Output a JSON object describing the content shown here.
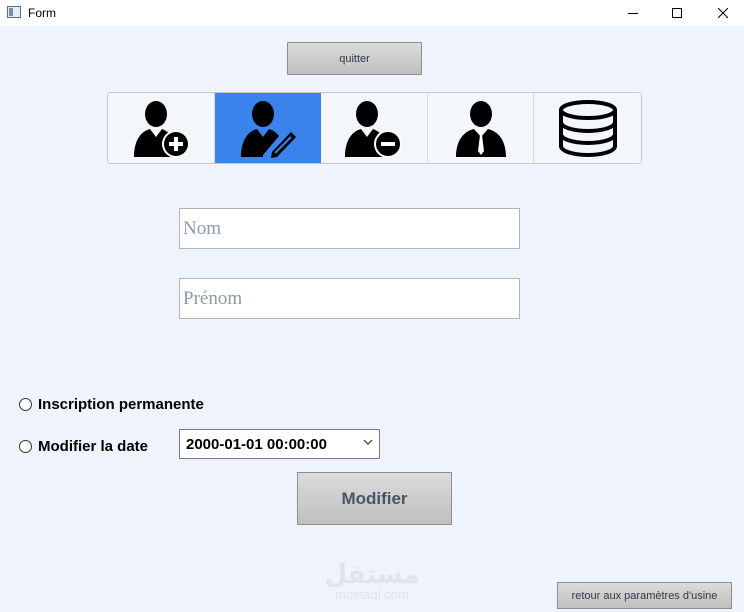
{
  "window": {
    "title": "Form",
    "controls": {
      "minimize_icon": "minimize-icon",
      "maximize_icon": "maximize-icon",
      "close_icon": "close-icon"
    }
  },
  "toolbar_top": {
    "quit_label": "quitter"
  },
  "tools": [
    {
      "id": "add-user",
      "icon": "user-add-icon",
      "active": false
    },
    {
      "id": "edit-user",
      "icon": "user-edit-icon",
      "active": true
    },
    {
      "id": "remove-user",
      "icon": "user-remove-icon",
      "active": false
    },
    {
      "id": "users",
      "icon": "user-tie-icon",
      "active": false
    },
    {
      "id": "database",
      "icon": "database-icon",
      "active": false
    }
  ],
  "form": {
    "nom_placeholder": "Nom",
    "prenom_placeholder": "Prénom",
    "nom_value": "",
    "prenom_value": "",
    "radio_permanent": "Inscription permanente",
    "radio_date": "Modifier la date",
    "date_value": "2000-01-01 00:00:00",
    "modify_label": "Modifier"
  },
  "footer": {
    "factory_reset_label": "retour aux paramètres d'usine"
  },
  "watermark": {
    "arabic": "مستقل",
    "latin": "mostaql.com"
  },
  "colors": {
    "accent": "#3a83ed",
    "background": "#eef3fc"
  }
}
